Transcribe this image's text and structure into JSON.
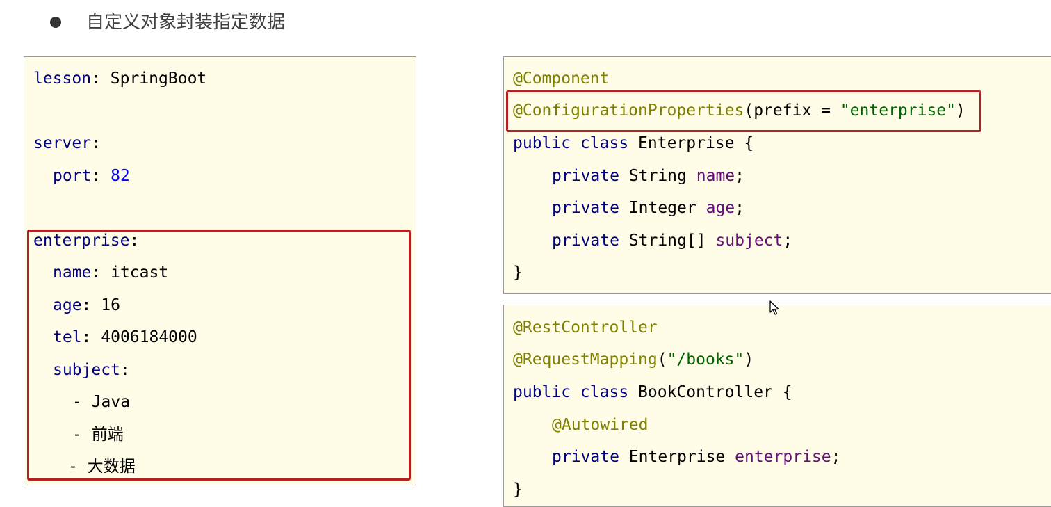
{
  "heading": {
    "bullet": "●",
    "text": "自定义对象封装指定数据"
  },
  "yaml": {
    "lesson_key": "lesson",
    "lesson_value": "SpringBoot",
    "server_key": "server",
    "port_key": "port",
    "port_value": "82",
    "enterprise_key": "enterprise",
    "name_key": "name",
    "name_value": "itcast",
    "age_key": "age",
    "age_value": "16",
    "tel_key": "tel",
    "tel_value": "4006184000",
    "subject_key": "subject",
    "subjects": [
      "Java",
      "前端",
      "大数据"
    ]
  },
  "enterprise_class": {
    "annotation_component": "@Component",
    "annotation_config": "@ConfigurationProperties",
    "config_param": "prefix = ",
    "config_value": "\"enterprise\"",
    "class_keywords": "public class",
    "class_name": "Enterprise {",
    "fields": [
      {
        "modifier": "private",
        "type": "String",
        "name": "name"
      },
      {
        "modifier": "private",
        "type": "Integer",
        "name": "age"
      },
      {
        "modifier": "private",
        "type": "String[]",
        "name": "subject"
      }
    ],
    "closing_brace": "}"
  },
  "controller_class": {
    "annotation_rest": "@RestController",
    "annotation_mapping": "@RequestMapping",
    "mapping_value": "\"/books\"",
    "class_keywords": "public class",
    "class_name": "BookController {",
    "annotation_autowired": "@Autowired",
    "field_modifier": "private",
    "field_type": "Enterprise",
    "field_name": "enterprise",
    "closing_brace": "}"
  },
  "colors": {
    "panel_background": "#fffde7",
    "highlight_border": "#b22222",
    "annotation": "#808000",
    "keyword": "#000080",
    "field": "#660e7a",
    "string": "#006400",
    "number": "#0000ff"
  },
  "icons": {
    "pointer": "mouse-pointer-icon"
  }
}
